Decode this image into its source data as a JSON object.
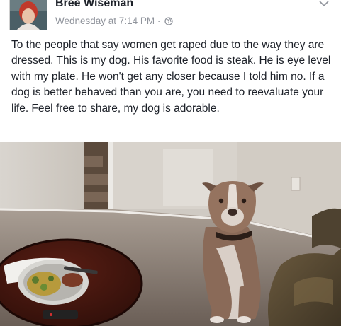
{
  "post": {
    "author": "Bree Wiseman",
    "timestamp": "Wednesday at 7:14 PM",
    "separator": "·",
    "audience_icon": "globe-icon",
    "menu_icon": "chevron-down-icon",
    "text": "To the people that say women get raped due to the way they are dressed. This is my dog. His favorite food is steak. He is eye level with my plate. He won't get any closer because I told him no. If a dog is better behaved than you are, you need to reevaluate your life. Feel free to share, my dog is adorable."
  },
  "colors": {
    "meta_text": "#90949c",
    "body_text": "#1d2129",
    "dog_fur": "#8a6a58"
  }
}
